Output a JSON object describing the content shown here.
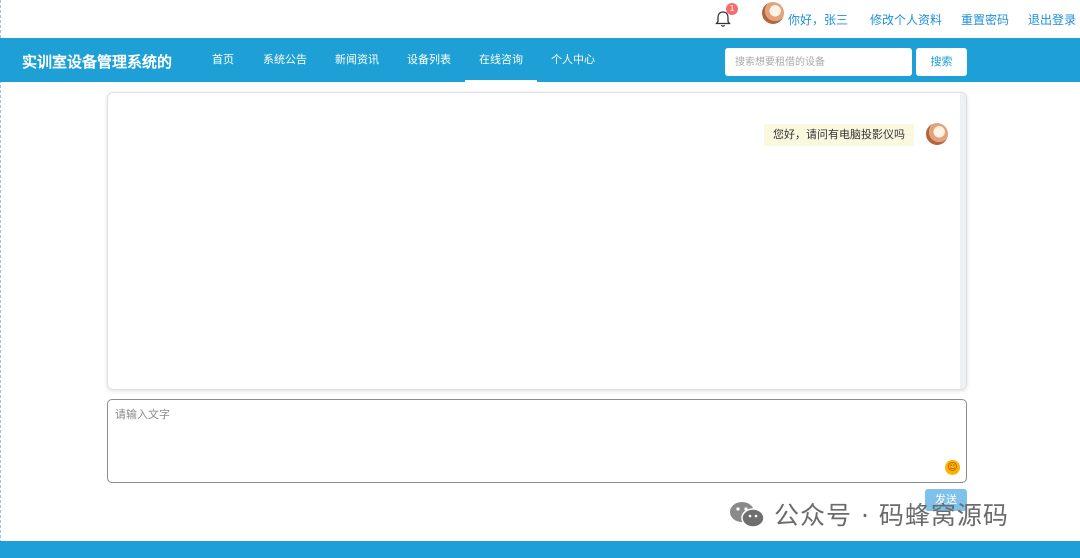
{
  "topbar": {
    "notification_count": "1",
    "greeting": "你好，张三",
    "edit_profile": "修改个人资料",
    "reset_password": "重置密码",
    "logout": "退出登录"
  },
  "nav": {
    "brand": "实训室设备管理系统的",
    "items": [
      {
        "label": "首页"
      },
      {
        "label": "系统公告"
      },
      {
        "label": "新闻资讯"
      },
      {
        "label": "设备列表"
      },
      {
        "label": "在线咨询"
      },
      {
        "label": "个人中心"
      }
    ],
    "active_item": "在线咨询",
    "search_placeholder": "搜索想要租借的设备",
    "search_button": "搜索"
  },
  "chat": {
    "messages": [
      {
        "sender": "self",
        "text": "您好，请问有电脑投影仪吗"
      }
    ]
  },
  "composer": {
    "placeholder": "请输入文字",
    "value": "",
    "send_label": "发送",
    "emoji_icon": "smile-emoji-icon"
  },
  "watermark": {
    "text": "公众号 · 码蜂窝源码",
    "icon": "wechat-icon"
  },
  "colors": {
    "primary": "#1ea0d7",
    "link": "#1e90d6",
    "badge": "#f56c6c",
    "bubble": "#fbf8e0"
  }
}
